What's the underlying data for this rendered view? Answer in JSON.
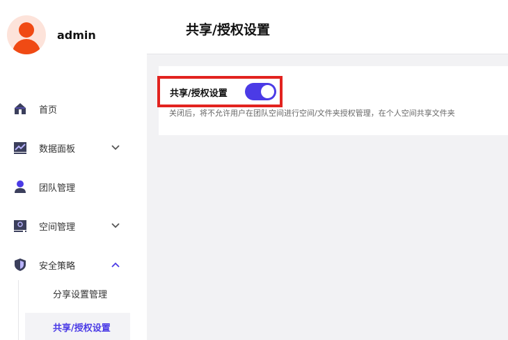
{
  "user": {
    "name": "admin"
  },
  "header": {
    "title": "共享/授权设置"
  },
  "sidebar": {
    "items": [
      {
        "label": "首页",
        "icon": "home-icon"
      },
      {
        "label": "数据面板",
        "icon": "chart-icon",
        "expandable": true,
        "expanded": false
      },
      {
        "label": "团队管理",
        "icon": "team-icon"
      },
      {
        "label": "空间管理",
        "icon": "storage-icon",
        "expandable": true,
        "expanded": false
      },
      {
        "label": "安全策略",
        "icon": "shield-icon",
        "expandable": true,
        "expanded": true
      }
    ],
    "subitems": [
      {
        "label": "分享设置管理",
        "active": false
      },
      {
        "label": "共享/授权设置",
        "active": true
      }
    ]
  },
  "setting": {
    "label": "共享/授权设置",
    "enabled": true,
    "description": "关闭后，将不允许用户在团队空间进行空间/文件夹授权管理，在个人空间共享文件夹"
  },
  "colors": {
    "accent": "#4b3be6",
    "highlight": "#e2231f",
    "avatar": "#f04a14"
  }
}
